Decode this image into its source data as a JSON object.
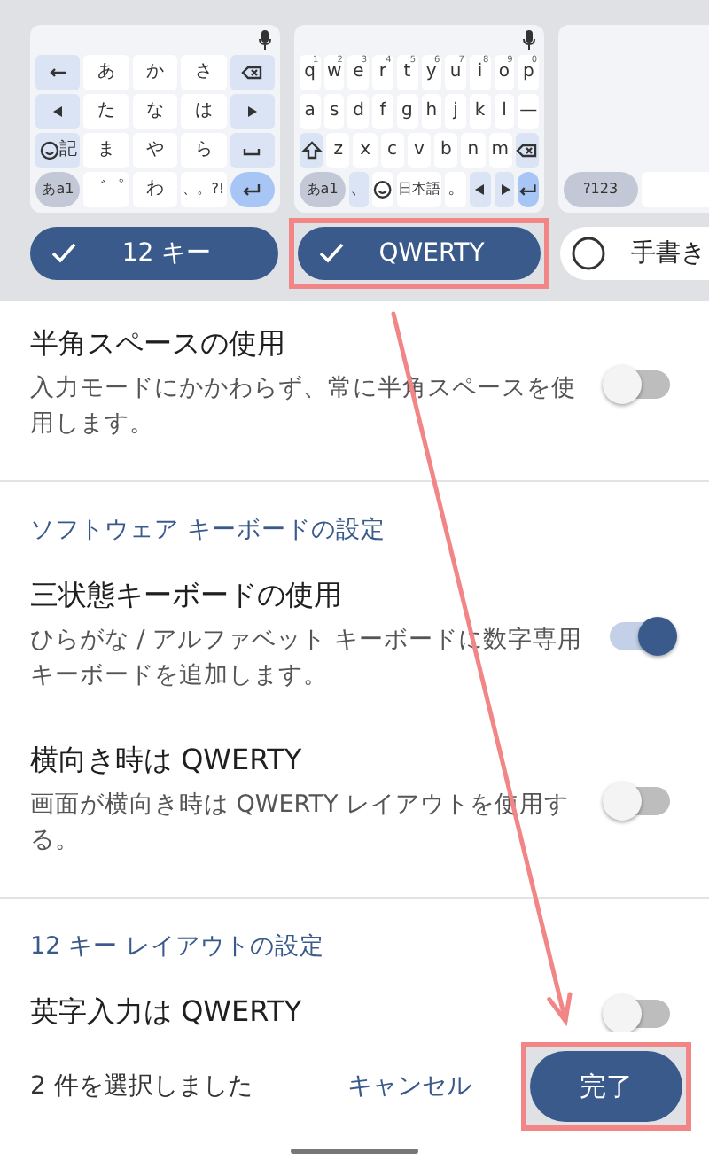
{
  "keyboards": [
    {
      "mic": true,
      "rows": [
        {
          "keys": [
            {
              "kind": "undo",
              "shaded": true
            },
            {
              "kind": "char",
              "label": "あ",
              "shaded": false
            },
            {
              "kind": "char",
              "label": "か",
              "shaded": false
            },
            {
              "kind": "char",
              "label": "さ",
              "shaded": false
            },
            {
              "kind": "backspace",
              "shaded": true
            }
          ]
        },
        {
          "keys": [
            {
              "kind": "left",
              "shaded": true
            },
            {
              "kind": "char",
              "label": "た",
              "shaded": false
            },
            {
              "kind": "char",
              "label": "な",
              "shaded": false
            },
            {
              "kind": "char",
              "label": "は",
              "shaded": false
            },
            {
              "kind": "right",
              "shaded": true
            }
          ]
        },
        {
          "keys": [
            {
              "kind": "emoji",
              "label": "記",
              "shaded": true
            },
            {
              "kind": "char",
              "label": "ま",
              "shaded": false
            },
            {
              "kind": "char",
              "label": "や",
              "shaded": false
            },
            {
              "kind": "char",
              "label": "ら",
              "shaded": false
            },
            {
              "kind": "space",
              "shaded": true
            }
          ]
        },
        {
          "keys": [
            {
              "kind": "mode",
              "label": "あa1"
            },
            {
              "kind": "char",
              "label": "゛゜",
              "shaded": false
            },
            {
              "kind": "char",
              "label": "わ",
              "shaded": false
            },
            {
              "kind": "char",
              "label": "、。?!",
              "shaded": false
            },
            {
              "kind": "enter"
            }
          ]
        }
      ]
    },
    {
      "mic": true,
      "rows": [
        {
          "keys": [
            {
              "kind": "char",
              "label": "q",
              "hint": "1",
              "shaded": false
            },
            {
              "kind": "char",
              "label": "w",
              "hint": "2",
              "shaded": false
            },
            {
              "kind": "char",
              "label": "e",
              "hint": "3",
              "shaded": false
            },
            {
              "kind": "char",
              "label": "r",
              "hint": "4",
              "shaded": false
            },
            {
              "kind": "char",
              "label": "t",
              "hint": "5",
              "shaded": false
            },
            {
              "kind": "char",
              "label": "y",
              "hint": "6",
              "shaded": false
            },
            {
              "kind": "char",
              "label": "u",
              "hint": "7",
              "shaded": false
            },
            {
              "kind": "char",
              "label": "i",
              "hint": "8",
              "shaded": false
            },
            {
              "kind": "char",
              "label": "o",
              "hint": "9",
              "shaded": false
            },
            {
              "kind": "char",
              "label": "p",
              "hint": "0",
              "shaded": false
            }
          ]
        },
        {
          "keys": [
            {
              "kind": "char",
              "label": "a",
              "shaded": false
            },
            {
              "kind": "char",
              "label": "s",
              "shaded": false
            },
            {
              "kind": "char",
              "label": "d",
              "shaded": false
            },
            {
              "kind": "char",
              "label": "f",
              "shaded": false
            },
            {
              "kind": "char",
              "label": "g",
              "shaded": false
            },
            {
              "kind": "char",
              "label": "h",
              "shaded": false
            },
            {
              "kind": "char",
              "label": "j",
              "shaded": false
            },
            {
              "kind": "char",
              "label": "k",
              "shaded": false
            },
            {
              "kind": "char",
              "label": "l",
              "shaded": false
            },
            {
              "kind": "char",
              "label": "—",
              "shaded": false
            }
          ]
        },
        {
          "keys": [
            {
              "kind": "shift",
              "shaded": true
            },
            {
              "kind": "char",
              "label": "z",
              "shaded": false
            },
            {
              "kind": "char",
              "label": "x",
              "shaded": false
            },
            {
              "kind": "char",
              "label": "c",
              "shaded": false
            },
            {
              "kind": "char",
              "label": "v",
              "shaded": false
            },
            {
              "kind": "char",
              "label": "b",
              "shaded": false
            },
            {
              "kind": "char",
              "label": "n",
              "shaded": false
            },
            {
              "kind": "char",
              "label": "m",
              "shaded": false
            },
            {
              "kind": "backspace",
              "shaded": true
            }
          ]
        },
        {
          "keys": [
            {
              "kind": "mode",
              "label": "あa1",
              "wide": true
            },
            {
              "kind": "char",
              "label": "、",
              "shaded": true,
              "wide": false
            },
            {
              "kind": "emoji",
              "shaded": false,
              "wide": false
            },
            {
              "kind": "char",
              "label": "日本語",
              "shaded": false,
              "wide": true
            },
            {
              "kind": "char",
              "label": "。",
              "shaded": false,
              "wide": false
            },
            {
              "kind": "left",
              "shaded": true,
              "wide": false
            },
            {
              "kind": "right",
              "shaded": true,
              "wide": false
            },
            {
              "kind": "enter",
              "wide": false
            }
          ]
        }
      ]
    },
    {
      "mic": false,
      "rows": [
        {
          "keys": [
            {
              "kind": "mode",
              "label": "?123",
              "wide": false
            },
            {
              "kind": "blank",
              "shaded": false,
              "wide": true
            }
          ]
        }
      ]
    }
  ],
  "layout_chips": [
    {
      "label": "12 キー",
      "selected": true,
      "highlighted": false
    },
    {
      "label": "QWERTY",
      "selected": true,
      "highlighted": true
    },
    {
      "label": "手書き",
      "selected": false,
      "highlighted": false
    }
  ],
  "settings": [
    {
      "kind": "toggle",
      "title": "半角スペースの使用",
      "description": "入力モードにかかわらず、常に半角スペースを使用します。",
      "on": false
    },
    {
      "kind": "section",
      "title": "ソフトウェア キーボードの設定"
    },
    {
      "kind": "toggle",
      "title": "三状態キーボードの使用",
      "description": "ひらがな / アルファベット キーボードに数字専用キーボードを追加します。",
      "on": true
    },
    {
      "kind": "toggle",
      "title": "横向き時は QWERTY",
      "description": "画面が横向き時は QWERTY レイアウトを使用する。",
      "on": false
    },
    {
      "kind": "section",
      "title": "12 キー レイアウトの設定"
    },
    {
      "kind": "toggle",
      "title": "英字入力は QWERTY",
      "on": false
    }
  ],
  "footer": {
    "status": "2 件を選択しました",
    "cancel": "キャンセル",
    "done": {
      "label": "完了",
      "highlighted": true
    }
  },
  "annotation_arrow": true
}
